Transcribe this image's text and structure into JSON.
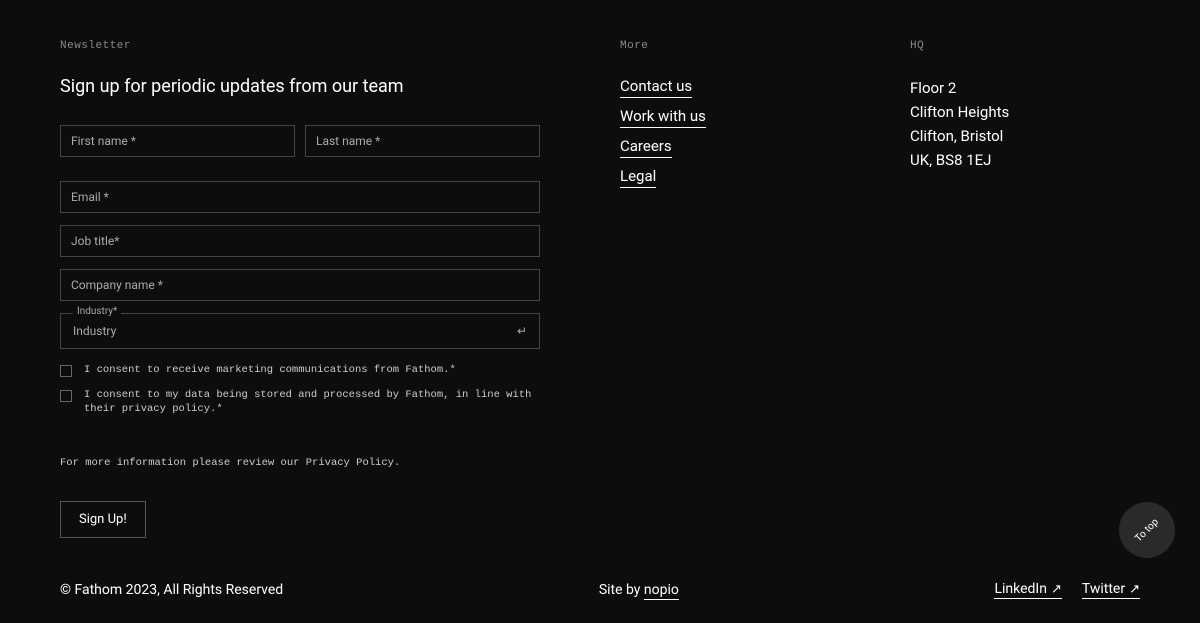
{
  "newsletter": {
    "section_label": "Newsletter",
    "heading": "Sign up for periodic updates from our team",
    "fields": {
      "first_name_placeholder": "First name *",
      "last_name_placeholder": "Last name *",
      "email_placeholder": "Email *",
      "job_title_placeholder": "Job title*",
      "company_name_placeholder": "Company name *",
      "industry_legend": "Industry*",
      "industry_selected": "Industry"
    },
    "consents": {
      "marketing": "I consent to receive marketing communications from Fathom.*",
      "privacy": "I consent to my data being stored and processed by Fathom, in line with their privacy policy.*"
    },
    "privacy_note": "For more information please review our Privacy Policy.",
    "submit_label": "Sign Up!"
  },
  "more": {
    "section_label": "More",
    "links": {
      "contact": "Contact us",
      "work": "Work with us",
      "careers": "Careers",
      "legal": "Legal"
    }
  },
  "hq": {
    "section_label": "HQ",
    "address": {
      "line1": "Floor 2",
      "line2": "Clifton Heights",
      "line3": "Clifton, Bristol",
      "line4": "UK, BS8 1EJ"
    }
  },
  "footer": {
    "copyright": "© Fathom 2023, All Rights Reserved",
    "site_by_prefix": "Site by ",
    "site_by_name": "nopio",
    "linkedin": "LinkedIn",
    "twitter": "Twitter"
  },
  "to_top_label": "To top"
}
